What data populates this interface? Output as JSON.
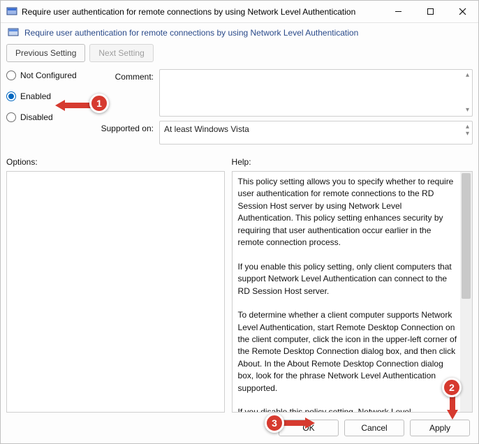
{
  "titlebar": {
    "title": "Require user authentication for remote connections by using Network Level Authentication"
  },
  "subheader": {
    "title": "Require user authentication for remote connections by using Network Level Authentication"
  },
  "nav": {
    "prev": "Previous Setting",
    "next": "Next Setting"
  },
  "radios": {
    "not_configured": "Not Configured",
    "enabled": "Enabled",
    "disabled": "Disabled",
    "selected": "enabled"
  },
  "labels": {
    "comment": "Comment:",
    "supported": "Supported on:",
    "options": "Options:",
    "help": "Help:"
  },
  "supported_text": "At least Windows Vista",
  "help_text": "This policy setting allows you to specify whether to require user authentication for remote connections to the RD Session Host server by using Network Level Authentication. This policy setting enhances security by requiring that user authentication occur earlier in the remote connection process.\n\nIf you enable this policy setting, only client computers that support Network Level Authentication can connect to the RD Session Host server.\n\nTo determine whether a client computer supports Network Level Authentication, start Remote Desktop Connection on the client computer, click the icon in the upper-left corner of the Remote Desktop Connection dialog box, and then click About. In the About Remote Desktop Connection dialog box, look for the phrase Network Level Authentication supported.\n\nIf you disable this policy setting, Network Level Authentication not required for user authentication before allowing remote connections to the RD Session Host server.",
  "footer": {
    "ok": "OK",
    "cancel": "Cancel",
    "apply": "Apply"
  },
  "annotations": {
    "b1": "1",
    "b2": "2",
    "b3": "3"
  }
}
